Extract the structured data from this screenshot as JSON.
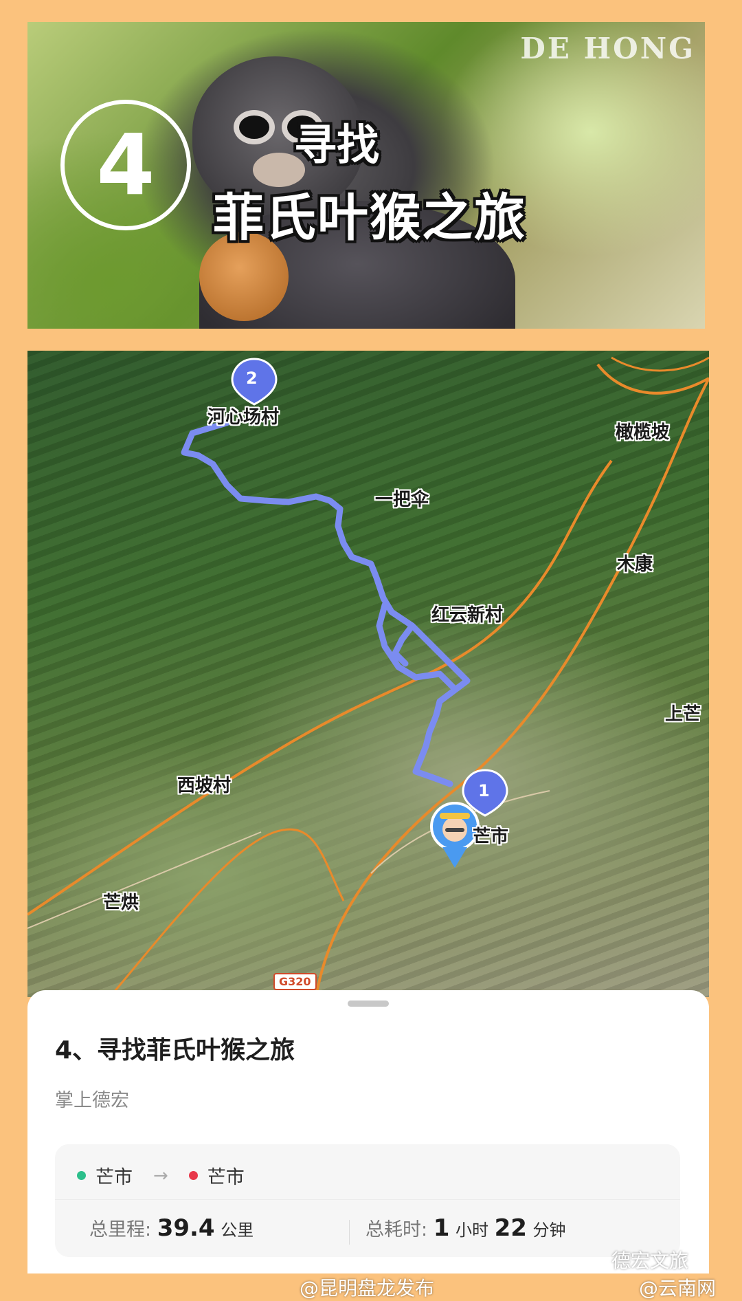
{
  "banner": {
    "number": "4",
    "title_line1": "寻找",
    "title_line2": "菲氏叶猴之旅",
    "watermark": "DE HONG"
  },
  "map": {
    "labels": {
      "hexinchang": "河心场村",
      "ganlanpo": "橄榄坡",
      "yibasan": "一把伞",
      "mukang": "木康",
      "hongyun": "红云新村",
      "shangmang": "上芒",
      "xipo": "西坡村",
      "manghong": "芒烘",
      "mangshi": "芒市"
    },
    "marker_start": "1",
    "marker_end": "2",
    "road_badge": "G320",
    "route_color": "#7B8CF0"
  },
  "sheet": {
    "title": "4、寻找菲氏叶猴之旅",
    "subtitle": "掌上德宏",
    "from": "芒市",
    "to": "芒市",
    "arrow": "→",
    "distance_label": "总里程:",
    "distance_value": "39.4",
    "distance_unit": "公里",
    "time_label": "总耗时:",
    "time_hours": "1",
    "time_hours_unit": "小时",
    "time_minutes": "22",
    "time_minutes_unit": "分钟",
    "start_dot_color": "#2CBF8B",
    "end_dot_color": "#E8384B"
  },
  "footer": {
    "weibo": "@昆明盘龙发布",
    "dehong": "德宏文旅",
    "yunnan": "@云南网"
  }
}
